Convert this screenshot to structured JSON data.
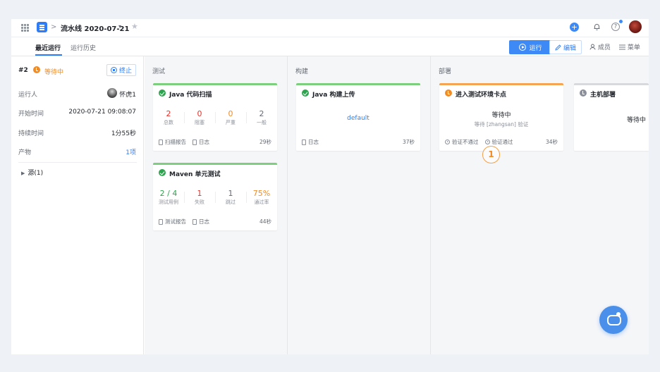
{
  "header": {
    "breadcrumb_sep": ">",
    "pipeline_title": "流水线 2020-07-21",
    "caret": "▾",
    "star": "★",
    "plus": "+",
    "help": "?"
  },
  "tabs": [
    {
      "label": "最近运行",
      "active": true
    },
    {
      "label": "运行历史",
      "active": false
    }
  ],
  "toolbar": {
    "run_label": "运行",
    "edit_label": "编辑",
    "members_label": "成员",
    "menu_label": "菜单"
  },
  "run": {
    "number": "#2",
    "status": "等待中",
    "stop_label": "终止",
    "fields": [
      {
        "label": "运行人",
        "value": "怀虎1"
      },
      {
        "label": "开始时间",
        "value": "2020-07-21 09:08:07"
      },
      {
        "label": "持续时间",
        "value": "1分55秒"
      },
      {
        "label": "产物",
        "value": "1项"
      }
    ],
    "source_label": "源(1)"
  },
  "stages": [
    {
      "title": "测试",
      "jobs": [
        {
          "title": "Java 代码扫描",
          "metrics": [
            {
              "num": "2",
              "label": "总数"
            },
            {
              "num": "0",
              "label": "阻塞"
            },
            {
              "num": "0",
              "label": "严重"
            },
            {
              "num": "2",
              "label": "一般"
            }
          ],
          "footer": [
            "扫描报告",
            "日志"
          ],
          "time": "29秒"
        },
        {
          "title": "Maven 单元测试",
          "metrics": [
            {
              "num": "2 / 4",
              "label": "测试用例"
            },
            {
              "num": "1",
              "label": "失败"
            },
            {
              "num": "1",
              "label": "跳过"
            },
            {
              "num": "75%",
              "label": "通过率"
            }
          ],
          "footer": [
            "测试报告",
            "日志"
          ],
          "time": "44秒"
        }
      ]
    },
    {
      "title": "构建",
      "jobs": [
        {
          "title": "Java 构建上传",
          "link": "default",
          "footer": [
            "日志"
          ],
          "time": "37秒"
        }
      ]
    },
    {
      "title": "部署",
      "jobs": [
        {
          "title": "进入测试环境卡点",
          "state": "等待中",
          "sub": "等待 [zhangsan] 验证",
          "footer": [
            "验证不通过",
            "验证通过"
          ],
          "time": "34秒"
        },
        {
          "title": "主机部署",
          "state": "等待中"
        }
      ]
    }
  ],
  "callout": "1",
  "colors": {
    "primary": "#2f7df6",
    "success": "#2da44e",
    "warning": "#f08b26",
    "danger": "#e5322b"
  }
}
